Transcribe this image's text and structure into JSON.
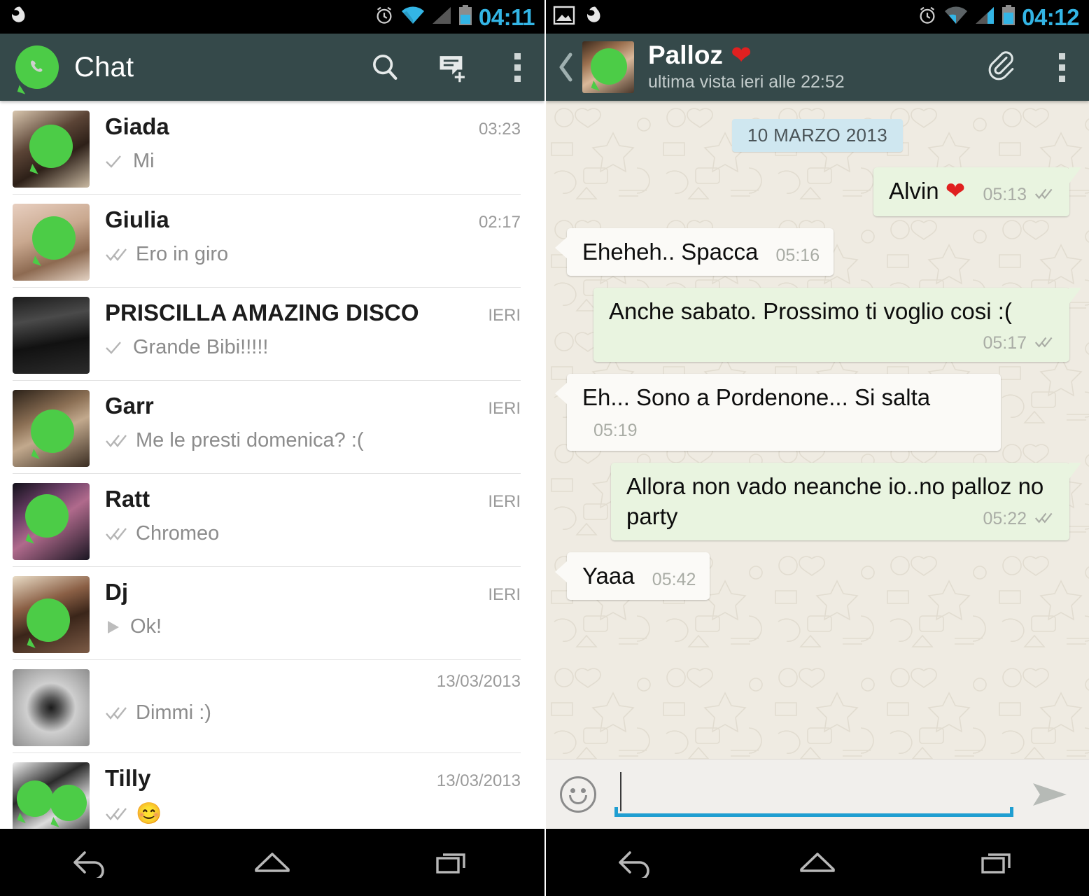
{
  "left_phone": {
    "status_bar": {
      "time": "04:11",
      "icons": [
        "app-notification-icon",
        "alarm-icon",
        "wifi-icon",
        "signal-icon",
        "battery-icon"
      ]
    },
    "action_bar": {
      "title": "Chat",
      "logo_icon": "whatsapp-logo-icon",
      "actions": [
        "search-icon",
        "new-chat-icon",
        "overflow-menu-icon"
      ]
    },
    "chats": [
      {
        "name": "Giada",
        "time": "03:23",
        "message": "Mi",
        "status": "sent",
        "avatar_logos": 1
      },
      {
        "name": "Giulia",
        "time": "02:17",
        "message": "Ero in giro",
        "status": "delivered",
        "avatar_logos": 1
      },
      {
        "name": "PRISCILLA AMAZING DISCO",
        "time": "IERI",
        "message": "Grande Bibi!!!!!",
        "status": "sent",
        "avatar_logos": 0
      },
      {
        "name": "Garr",
        "time": "IERI",
        "message": "Me le presti domenica? :(",
        "status": "delivered",
        "avatar_logos": 1
      },
      {
        "name": "Ratt",
        "time": "IERI",
        "message": "Chromeo",
        "status": "delivered",
        "avatar_logos": 1
      },
      {
        "name": "Dj",
        "time": "IERI",
        "message": "Ok!",
        "status": "pending",
        "avatar_logos": 1
      },
      {
        "name": "",
        "time": "13/03/2013",
        "message": "Dimmi :)",
        "status": "delivered",
        "avatar_logos": 0,
        "redacted": true
      },
      {
        "name": "Tilly",
        "time": "13/03/2013",
        "message": "",
        "status": "delivered",
        "avatar_logos": 2
      }
    ],
    "nav_bar": {
      "buttons": [
        "back-icon",
        "home-icon",
        "recents-icon"
      ]
    }
  },
  "right_phone": {
    "status_bar": {
      "time": "04:12",
      "icons": [
        "screenshot-icon",
        "app-notification-icon",
        "alarm-icon",
        "wifi-icon",
        "signal-icon",
        "battery-icon"
      ]
    },
    "conversation_bar": {
      "back_icon": "back-chevron-icon",
      "contact_name": "Palloz",
      "contact_name_emoji": "❤",
      "last_seen": "ultima vista ieri alle 22:52",
      "actions": [
        "attach-paperclip-icon",
        "overflow-menu-icon"
      ]
    },
    "date_divider": "10 MARZO 2013",
    "messages": [
      {
        "direction": "out",
        "text": "Alvin",
        "emoji": "❤",
        "time": "05:13",
        "status": "delivered",
        "wrap_meta": false
      },
      {
        "direction": "in",
        "text": "Eheheh.. Spacca",
        "time": "05:16",
        "wrap_meta": false
      },
      {
        "direction": "out",
        "text": "Anche sabato. Prossimo ti voglio cosi :(",
        "time": "05:17",
        "status": "delivered",
        "wrap_meta": true
      },
      {
        "direction": "in",
        "text": "Eh... Sono a Pordenone... Si salta",
        "time": "05:19",
        "wrap_meta": false
      },
      {
        "direction": "out",
        "text": "Allora non vado neanche io..no palloz no party",
        "time": "05:22",
        "status": "delivered",
        "wrap_meta": true
      },
      {
        "direction": "in",
        "text": "Yaaa",
        "time": "05:42",
        "wrap_meta": false
      }
    ],
    "composer": {
      "emoji_icon": "smiley-icon",
      "input_value": "",
      "input_placeholder": "",
      "send_icon": "send-icon"
    },
    "nav_bar": {
      "buttons": [
        "back-icon",
        "home-icon",
        "recents-icon"
      ]
    }
  },
  "colors": {
    "action_bar": "#35494a",
    "status_bar": "#000000",
    "accent_blue": "#33b5e5",
    "whatsapp_green": "#4ccc47",
    "outgoing_bubble": "#e9f4e0",
    "incoming_bubble": "#fbfaf7",
    "wallpaper": "#efebe2",
    "date_badge": "#cfe7f0",
    "input_underline": "#1f9ed1"
  }
}
